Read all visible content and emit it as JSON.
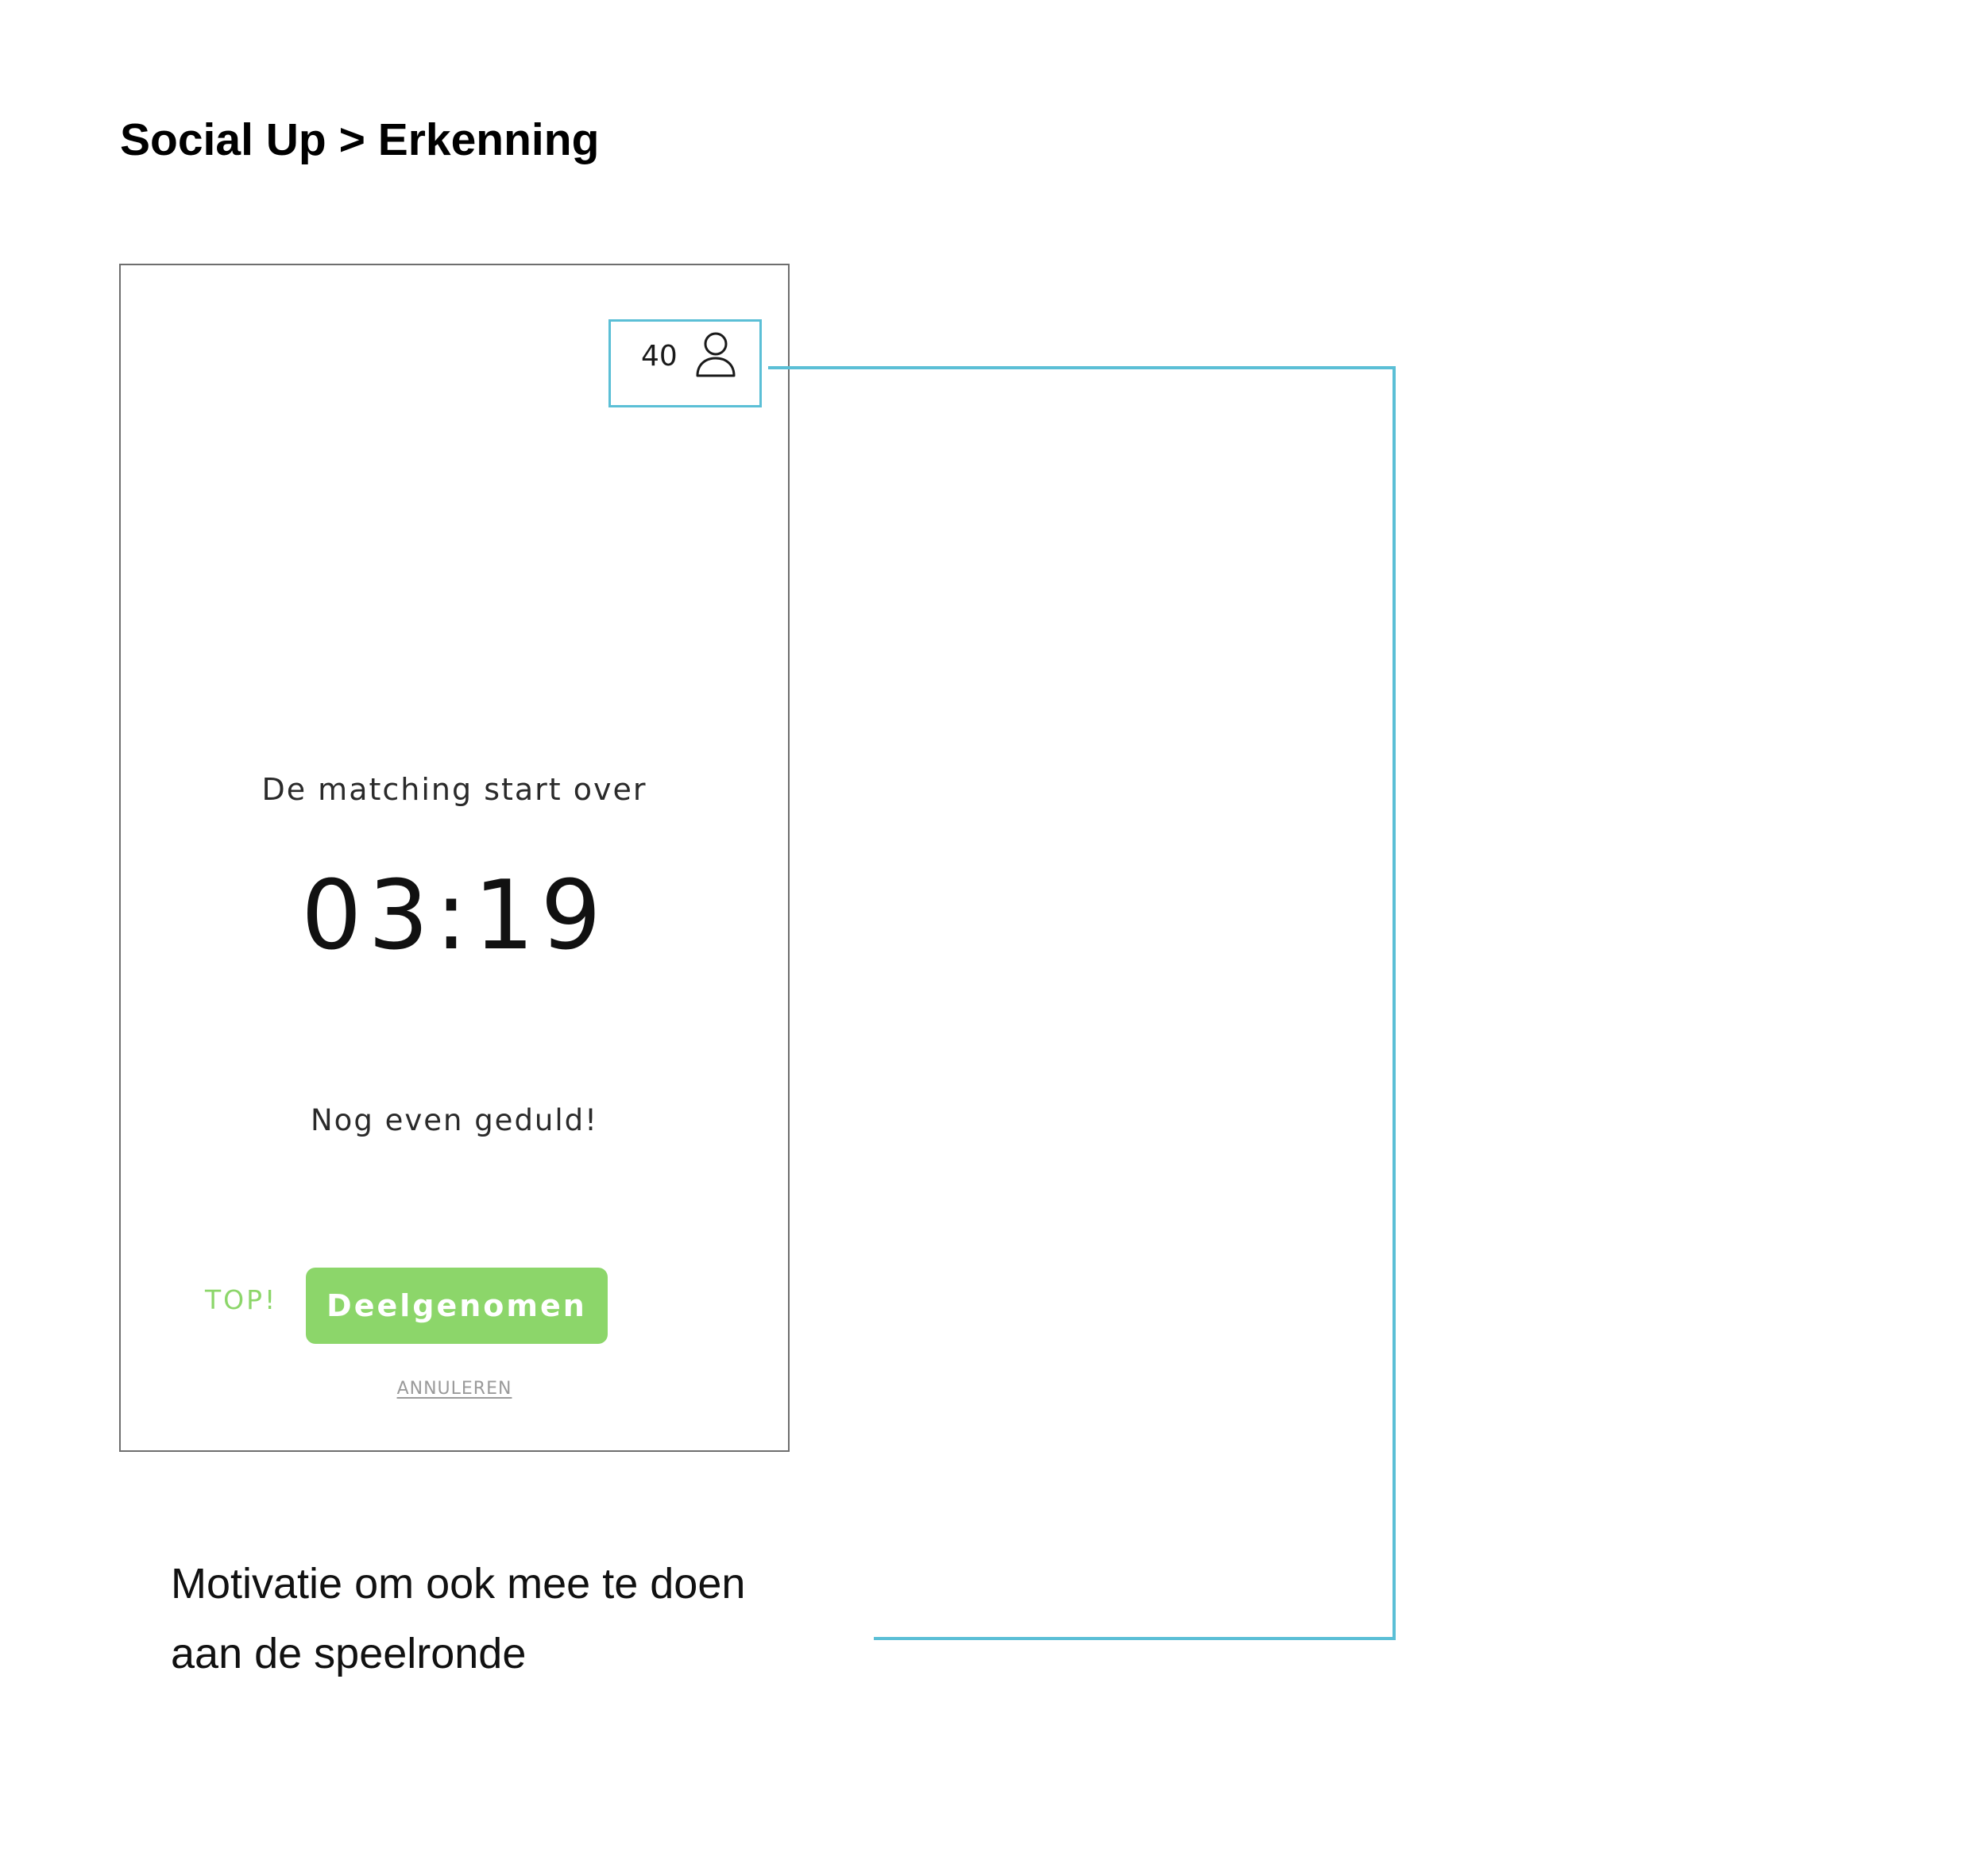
{
  "page": {
    "title": "Social Up > Erkenning"
  },
  "phone": {
    "participant_count": "40",
    "participant_icon": "user-icon",
    "match_label": "De matching start over",
    "countdown": "03:19",
    "patience_text": "Nog even geduld!",
    "top_label": "TOP!",
    "participated_button_label": "Deelgenomen",
    "cancel_label": "ANNULEREN"
  },
  "annotation": {
    "line1": "Motivatie om ook mee te doen",
    "line2": "aan de speelronde",
    "accent_color": "#5bbfd6"
  },
  "colors": {
    "button_green": "#8cd66a",
    "highlight_blue": "#5bbfd6"
  }
}
